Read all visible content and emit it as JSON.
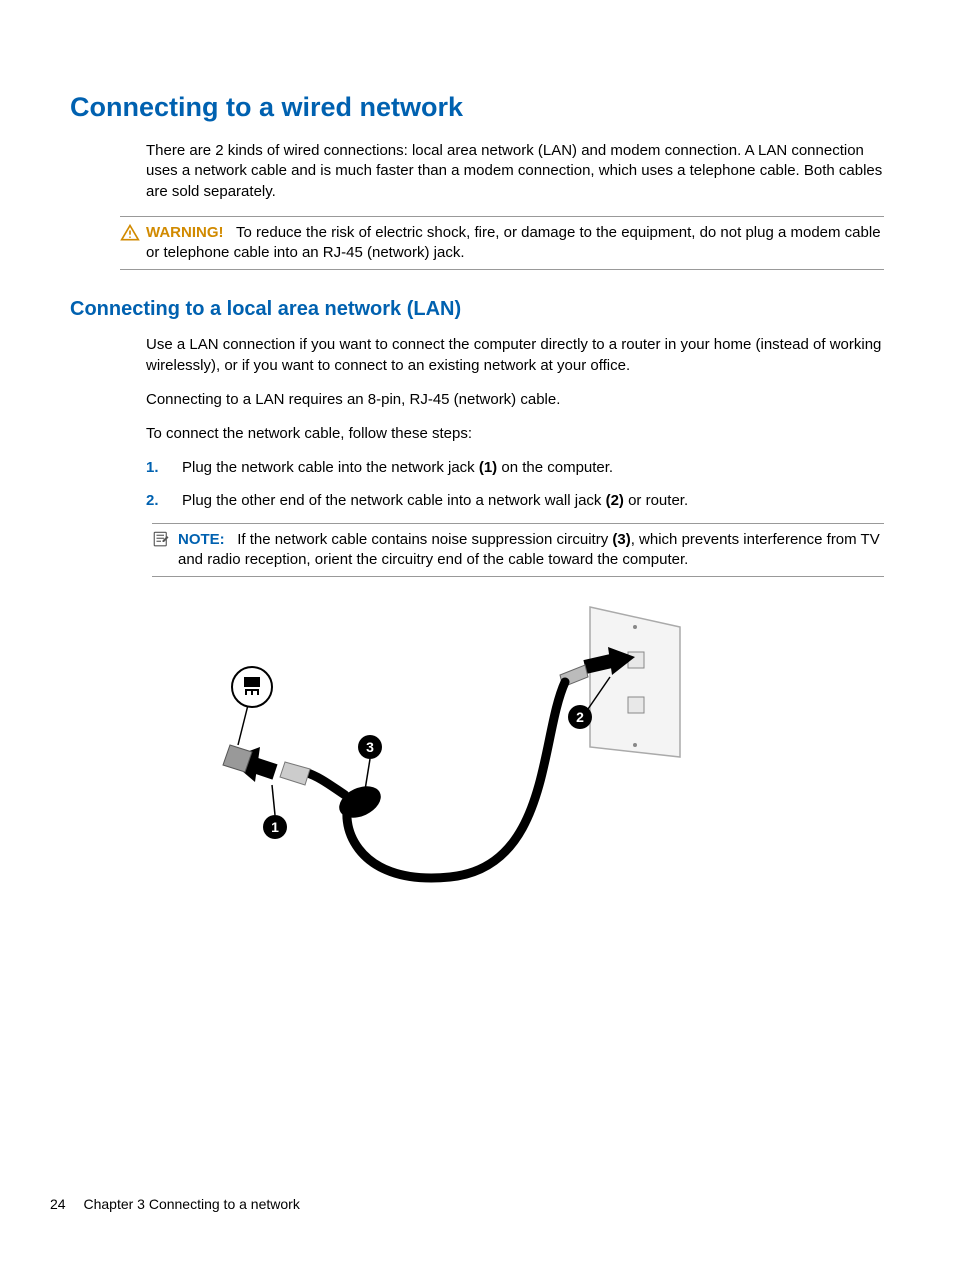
{
  "heading": "Connecting to a wired network",
  "intro": "There are 2 kinds of wired connections: local area network (LAN) and modem connection. A LAN connection uses a network cable and is much faster than a modem connection, which uses a telephone cable. Both cables are sold separately.",
  "warning": {
    "label": "WARNING!",
    "text": "To reduce the risk of electric shock, fire, or damage to the equipment, do not plug a modem cable or telephone cable into an RJ-45 (network) jack."
  },
  "subheading": "Connecting to a local area network (LAN)",
  "lan_intro": "Use a LAN connection if you want to connect the computer directly to a router in your home (instead of working wirelessly), or if you want to connect to an existing network at your office.",
  "lan_req": "Connecting to a LAN requires an 8-pin, RJ-45 (network) cable.",
  "lan_steps_lead": "To connect the network cable, follow these steps:",
  "steps": [
    {
      "num": "1.",
      "pre": "Plug the network cable into the network jack ",
      "bold": "(1)",
      "post": " on the computer."
    },
    {
      "num": "2.",
      "pre": "Plug the other end of the network cable into a network wall jack ",
      "bold": "(2)",
      "post": " or router."
    }
  ],
  "note": {
    "label": "NOTE:",
    "pre": "If the network cable contains noise suppression circuitry ",
    "bold": "(3)",
    "post": ", which prevents interference from TV and radio reception, orient the circuitry end of the cable toward the computer."
  },
  "footer": {
    "page": "24",
    "chapter": "Chapter 3   Connecting to a network"
  },
  "callouts": {
    "c1": "1",
    "c2": "2",
    "c3": "3"
  }
}
